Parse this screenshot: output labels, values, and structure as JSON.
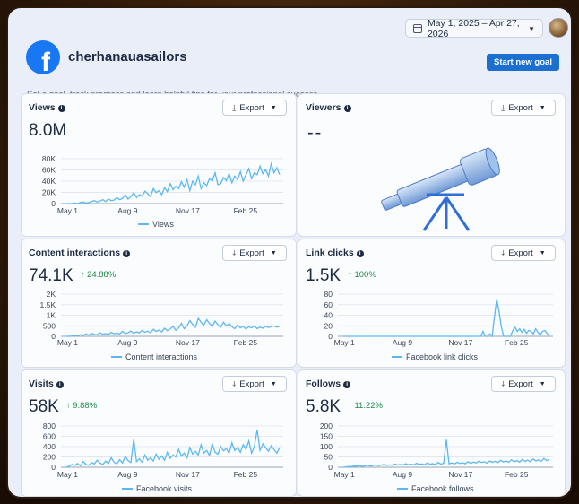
{
  "header": {
    "date_range": "May 1, 2025 – Apr 27, 2026",
    "page_name": "cherhanauasailors",
    "subtitle": "Set a goal, track progress and learn helpful tips for your professional success.",
    "goal_button": "Start new goal",
    "logo_letter": "f"
  },
  "export_label": "Export",
  "info_glyph": "i",
  "colors": {
    "accent": "#1b6fd1",
    "line": "#5bb8f2",
    "delta_up": "#1f8a4c",
    "facebook": "#1877f2"
  },
  "cards": {
    "views": {
      "title": "Views",
      "value": "8.0M",
      "delta": "",
      "legend": "Views"
    },
    "viewers": {
      "title": "Viewers",
      "value": "--"
    },
    "interactions": {
      "title": "Content interactions",
      "value": "74.1K",
      "delta": "↑ 24.88%",
      "legend": "Content interactions"
    },
    "link_clicks": {
      "title": "Link clicks",
      "value": "1.5K",
      "delta": "↑ 100%",
      "legend": "Facebook link clicks"
    },
    "visits": {
      "title": "Visits",
      "value": "58K",
      "delta": "↑ 9.88%",
      "legend": "Facebook visits"
    },
    "follows": {
      "title": "Follows",
      "value": "5.8K",
      "delta": "↑ 11.22%",
      "legend": "Facebook follows"
    }
  },
  "chart_data": [
    {
      "id": "views",
      "type": "line",
      "x_ticks": [
        "May 1",
        "Aug 9",
        "Nov 17",
        "Feb 25"
      ],
      "y_ticks": [
        "80K",
        "60K",
        "40K",
        "20K",
        "0"
      ],
      "ylim": [
        0,
        90000
      ],
      "series": [
        {
          "name": "Views",
          "values": [
            0,
            0,
            0,
            1000,
            0,
            2000,
            3000,
            1000,
            2000,
            4000,
            6000,
            3000,
            5000,
            8000,
            4000,
            9000,
            6000,
            7000,
            12000,
            8000,
            10000,
            18000,
            9000,
            14000,
            22000,
            12000,
            18000,
            15000,
            25000,
            20000,
            14000,
            30000,
            22000,
            26000,
            18000,
            32000,
            24000,
            40000,
            28000,
            35000,
            30000,
            44000,
            33000,
            48000,
            26000,
            45000,
            38000,
            55000,
            30000,
            42000,
            36000,
            50000,
            45000,
            62000,
            38000,
            40000,
            52000,
            46000,
            60000,
            42000,
            55000,
            48000,
            64000,
            45000,
            58000,
            70000,
            50000,
            62000,
            58000,
            75000,
            60000,
            68000,
            55000,
            80000,
            62000,
            72000,
            58000
          ]
        }
      ]
    },
    {
      "id": "interactions",
      "type": "line",
      "x_ticks": [
        "May 1",
        "Aug 9",
        "Nov 17",
        "Feb 25"
      ],
      "y_ticks": [
        "2K",
        "1.5K",
        "1K",
        "500",
        "0"
      ],
      "ylim": [
        0,
        2100
      ],
      "series": [
        {
          "name": "Content interactions",
          "values": [
            0,
            0,
            20,
            50,
            30,
            80,
            40,
            120,
            60,
            150,
            90,
            70,
            180,
            100,
            140,
            90,
            200,
            120,
            160,
            110,
            250,
            140,
            180,
            260,
            150,
            220,
            170,
            300,
            200,
            260,
            180,
            350,
            240,
            310,
            220,
            400,
            280,
            360,
            500,
            300,
            420,
            650,
            380,
            520,
            780,
            600,
            450,
            900,
            700,
            560,
            820,
            640,
            500,
            760,
            580,
            450,
            700,
            520,
            640,
            480,
            380,
            560,
            420,
            500,
            360,
            480,
            420,
            520,
            380,
            460,
            400,
            500,
            440,
            480,
            520,
            460,
            500
          ]
        }
      ]
    },
    {
      "id": "link_clicks",
      "type": "line",
      "x_ticks": [
        "May 1",
        "Aug 9",
        "Nov 17",
        "Feb 25"
      ],
      "y_ticks": [
        "80",
        "60",
        "40",
        "20",
        "0"
      ],
      "ylim": [
        0,
        85
      ],
      "series": [
        {
          "name": "Facebook link clicks",
          "values": [
            0,
            0,
            0,
            0,
            0,
            0,
            0,
            0,
            0,
            0,
            0,
            0,
            0,
            0,
            0,
            0,
            0,
            0,
            0,
            0,
            0,
            0,
            0,
            0,
            0,
            0,
            0,
            0,
            0,
            0,
            0,
            0,
            0,
            0,
            0,
            0,
            0,
            0,
            0,
            0,
            0,
            0,
            0,
            0,
            0,
            0,
            0,
            0,
            0,
            0,
            0,
            0,
            0,
            0,
            0,
            0,
            0,
            0,
            0,
            0,
            0,
            10,
            0,
            0,
            5,
            0,
            40,
            75,
            50,
            20,
            0,
            0,
            0,
            0,
            12,
            18,
            10,
            15,
            8,
            14,
            6,
            12,
            10,
            5,
            15,
            8,
            3,
            10,
            12,
            6,
            0
          ]
        }
      ]
    },
    {
      "id": "visits",
      "type": "line",
      "x_ticks": [
        "May 1",
        "Aug 9",
        "Nov 17",
        "Feb 25"
      ],
      "y_ticks": [
        "800",
        "600",
        "400",
        "200",
        "0"
      ],
      "ylim": [
        0,
        880
      ],
      "series": [
        {
          "name": "Facebook visits",
          "values": [
            0,
            20,
            60,
            40,
            80,
            30,
            120,
            60,
            40,
            100,
            70,
            150,
            90,
            60,
            130,
            80,
            200,
            110,
            70,
            160,
            90,
            230,
            140,
            100,
            600,
            120,
            180,
            110,
            260,
            150,
            200,
            130,
            280,
            170,
            240,
            150,
            320,
            190,
            260,
            220,
            380,
            240,
            300,
            200,
            420,
            280,
            340,
            260,
            480,
            300,
            360,
            250,
            500,
            320,
            280,
            440,
            350,
            400,
            300,
            520,
            360,
            420,
            320,
            480,
            380,
            560,
            300,
            440,
            800,
            360,
            500,
            420,
            340,
            460,
            380,
            300,
            420
          ]
        }
      ]
    },
    {
      "id": "follows",
      "type": "line",
      "x_ticks": [
        "May 1",
        "Aug 9",
        "Nov 17",
        "Feb 25"
      ],
      "y_ticks": [
        "200",
        "150",
        "100",
        "50",
        "0"
      ],
      "ylim": [
        0,
        210
      ],
      "series": [
        {
          "name": "Facebook follows",
          "values": [
            0,
            2,
            4,
            3,
            6,
            5,
            8,
            4,
            7,
            10,
            6,
            9,
            12,
            8,
            11,
            14,
            9,
            12,
            10,
            16,
            12,
            14,
            11,
            18,
            13,
            15,
            12,
            20,
            14,
            17,
            13,
            22,
            15,
            18,
            14,
            24,
            16,
            20,
            140,
            18,
            22,
            17,
            25,
            19,
            23,
            18,
            28,
            20,
            26,
            22,
            30,
            24,
            28,
            21,
            32,
            25,
            30,
            23,
            35,
            27,
            32,
            25,
            38,
            28,
            34,
            26,
            40,
            30,
            36,
            28,
            42,
            32,
            38,
            30,
            45,
            34,
            40
          ]
        }
      ]
    }
  ]
}
